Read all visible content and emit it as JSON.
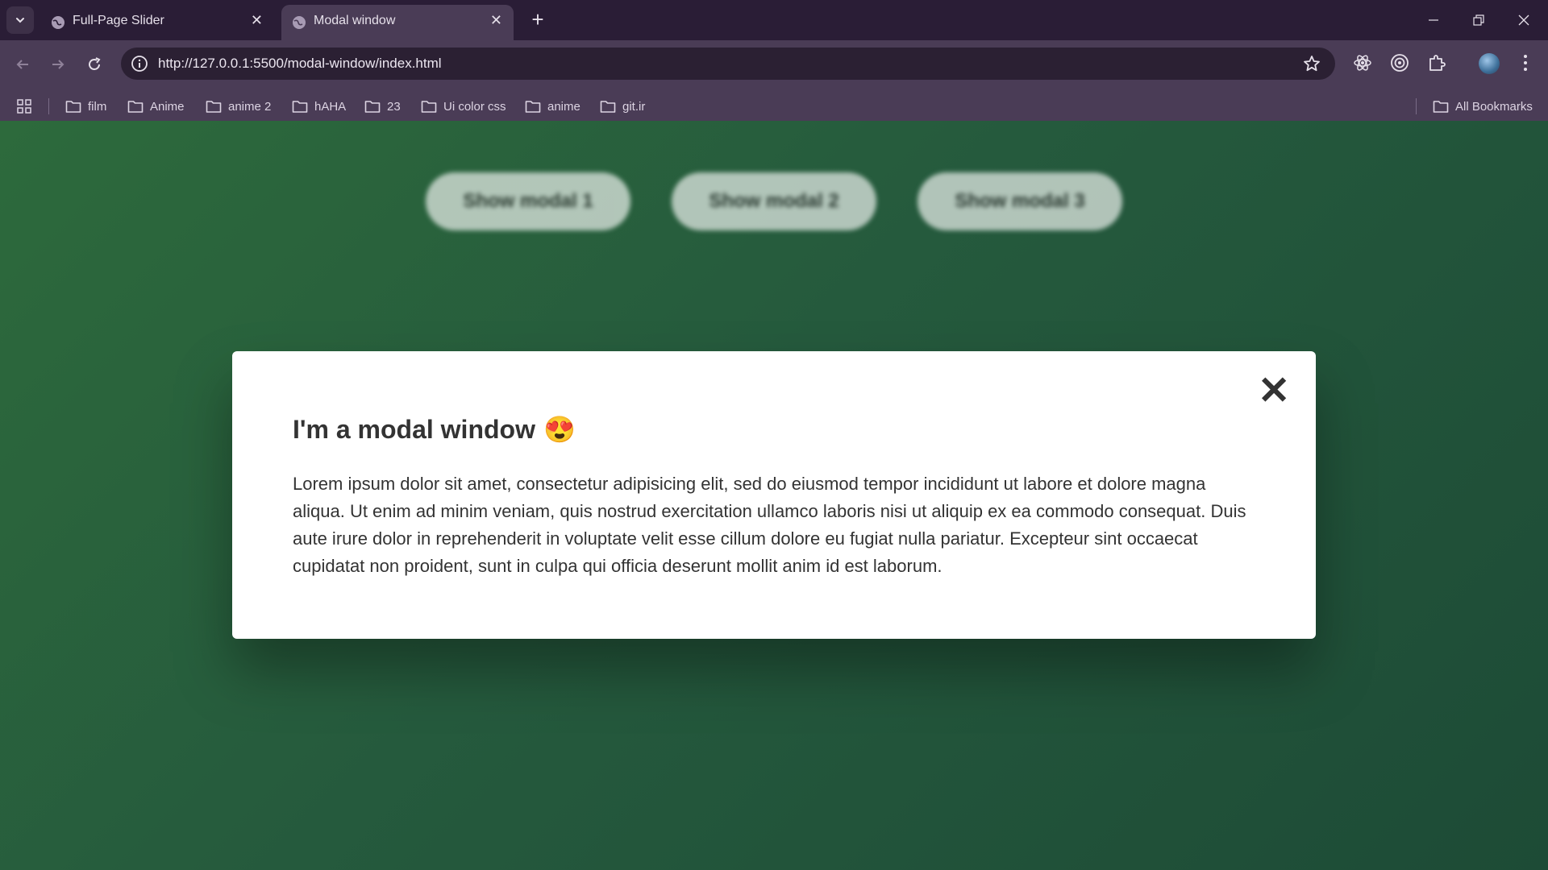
{
  "browser": {
    "tabs": [
      {
        "title": "Full-Page Slider",
        "active": false
      },
      {
        "title": "Modal window",
        "active": true
      }
    ],
    "url": "http://127.0.0.1:5500/modal-window/index.html",
    "bookmarks": [
      "film",
      "Anime",
      "anime 2",
      "hAHA",
      "23",
      "Ui color css",
      "anime",
      "git.ir"
    ],
    "all_bookmarks": "All Bookmarks"
  },
  "page": {
    "buttons": [
      "Show modal 1",
      "Show modal 2",
      "Show modal 3"
    ],
    "modal": {
      "title": "I'm a modal window",
      "emoji": "😍",
      "body": "Lorem ipsum dolor sit amet, consectetur adipisicing elit, sed do eiusmod tempor incididunt ut labore et dolore magna aliqua. Ut enim ad minim veniam, quis nostrud exercitation ullamco laboris nisi ut aliquip ex ea commodo consequat. Duis aute irure dolor in reprehenderit in voluptate velit esse cillum dolore eu fugiat nulla pariatur. Excepteur sint occaecat cupidatat non proident, sunt in culpa qui officia deserunt mollit anim id est laborum.",
      "close_glyph": "✕"
    }
  },
  "colors": {
    "page_bg_start": "#2d6a3c",
    "page_bg_end": "#1d4b36",
    "browser_frame": "#2a1d36",
    "toolbar": "#4a3c56"
  }
}
